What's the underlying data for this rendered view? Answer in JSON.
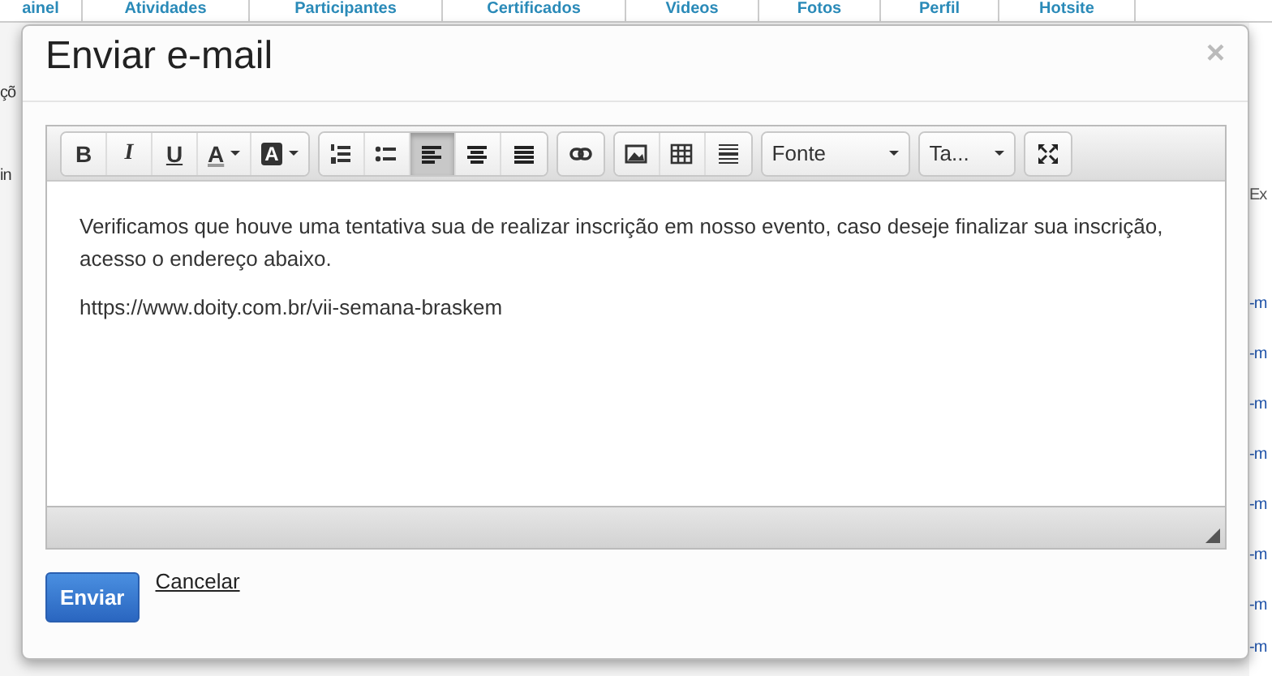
{
  "background": {
    "tabs": [
      "ainel",
      "Atividades",
      "Participantes",
      "Certificados",
      "Videos",
      "Fotos",
      "Perfil",
      "Hotsite"
    ],
    "left_fragments": [
      "çõ",
      "in"
    ],
    "right_fragments": [
      "Ex",
      "-m",
      "-m",
      "-m",
      "-m",
      "-m",
      "-m",
      "-m",
      "-m"
    ]
  },
  "modal": {
    "title": "Enviar e-mail",
    "close": "×",
    "toolbar": [
      [
        {
          "kind": "bold",
          "label": "B",
          "selected": false
        },
        {
          "kind": "italic",
          "label": "I",
          "selected": false
        },
        {
          "kind": "underline",
          "label": "U",
          "selected": false
        },
        {
          "kind": "font-color",
          "label": "A",
          "selected": false
        },
        {
          "kind": "highlight",
          "label": "A",
          "selected": false
        }
      ],
      [
        {
          "kind": "ordered-list",
          "selected": false
        },
        {
          "kind": "unordered-list",
          "selected": false
        },
        {
          "kind": "align-left",
          "selected": true
        },
        {
          "kind": "align-center",
          "selected": false
        },
        {
          "kind": "justify",
          "selected": false
        }
      ],
      [
        {
          "kind": "link",
          "selected": false
        }
      ],
      [
        {
          "kind": "image",
          "selected": false
        },
        {
          "kind": "table",
          "selected": false
        },
        {
          "kind": "hr",
          "selected": false
        }
      ],
      [
        {
          "kind": "select",
          "label": "Fonte",
          "selected": false
        }
      ],
      [
        {
          "kind": "select",
          "label": "Ta...",
          "selected": false
        }
      ],
      [
        {
          "kind": "fullscreen",
          "selected": false
        }
      ]
    ],
    "paragraphs": [
      "Verificamos que houve uma tentativa sua de realizar inscrição em nosso evento, caso deseje finalizar sua inscrição, acesso o endereço abaixo.",
      "https://www.doity.com.br/vii-semana-braskem"
    ],
    "submit": "Enviar",
    "cancel": "Cancelar"
  }
}
